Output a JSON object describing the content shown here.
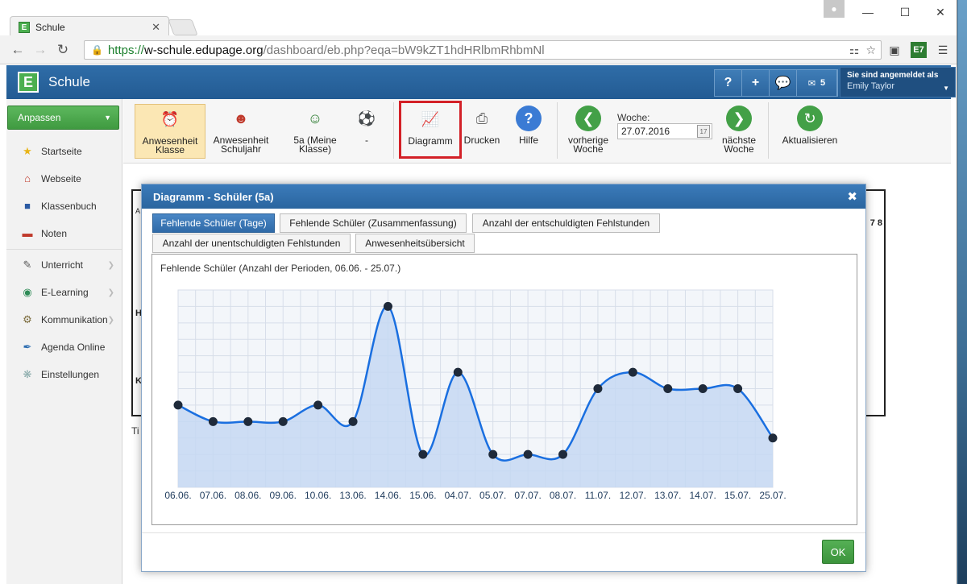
{
  "browser": {
    "tab_title": "Schule",
    "tab_favicon": "E",
    "url_scheme": "https://",
    "url_host": "w-schule.edupage.org",
    "url_path": "/dashboard/eb.php?eqa=bW9kZT1hdHRlbmRhbmNl"
  },
  "app": {
    "title": "Schule",
    "logo_letter": "E",
    "help_label": "?",
    "add_label": "+",
    "mail_count": "5",
    "user_label": "Sie sind angemeldet als",
    "user_name": "Emily Taylor"
  },
  "sidebar": {
    "customize_label": "Anpassen",
    "items": [
      {
        "label": "Startseite",
        "icon": "star-icon"
      },
      {
        "label": "Webseite",
        "icon": "house-icon"
      },
      {
        "label": "Klassenbuch",
        "icon": "book-icon"
      },
      {
        "label": "Noten",
        "icon": "notes-icon"
      },
      {
        "label": "Unterricht",
        "icon": "pencil-icon"
      },
      {
        "label": "E-Learning",
        "icon": "globe-icon"
      },
      {
        "label": "Kommunikation",
        "icon": "gear-icon"
      },
      {
        "label": "Agenda Online",
        "icon": "feather-icon"
      },
      {
        "label": "Einstellungen",
        "icon": "settings-icon"
      }
    ]
  },
  "toolbar": {
    "attendance_class_1": "Anwesenheit",
    "attendance_class_2": "Klasse",
    "attendance_year_1": "Anwesenheit",
    "attendance_year_2": "Schuljahr",
    "my_class_1": "5a (Meine",
    "my_class_2": "Klasse)",
    "dash_label": "-",
    "diagram_label": "Diagramm",
    "print_label": "Drucken",
    "help_label": "Hilfe",
    "prev_week_1": "vorherige",
    "prev_week_2": "Woche",
    "week_label": "Woche:",
    "week_value": "27.07.2016",
    "next_week_1": "nächste",
    "next_week_2": "Woche",
    "refresh_label": "Aktualisieren"
  },
  "modal": {
    "title": "Diagramm - Schüler (5a)",
    "tabs": [
      "Fehlende Schüler (Tage)",
      "Fehlende Schüler (Zusammenfassung)",
      "Anzahl der entschuldigten Fehlstunden",
      "Anzahl der unentschuldigten Fehlstunden",
      "Anwesenheitsübersicht"
    ],
    "ok_label": "OK"
  },
  "background": {
    "hint_text": "Ti",
    "col_nums": "7 8",
    "letter_h": "H",
    "letter_k": "K",
    "letter_a": "A"
  },
  "colors": {
    "header_blue": "#2a659f",
    "accent_green": "#4caf50",
    "highlight_red": "#d32027",
    "chart_line": "#1a6fe0",
    "chart_fill": "#c5d8f2"
  },
  "chart_data": {
    "type": "area",
    "title": "Fehlende Schüler (Anzahl der Perioden, 06.06. - 25.07.)",
    "categories": [
      "06.06.",
      "07.06.",
      "08.06.",
      "09.06.",
      "10.06.",
      "13.06.",
      "14.06.",
      "15.06.",
      "04.07.",
      "05.07.",
      "07.07.",
      "08.07.",
      "11.07.",
      "12.07.",
      "13.07.",
      "14.07.",
      "15.07.",
      "25.07."
    ],
    "values": [
      5,
      4,
      4,
      4,
      5,
      4,
      11,
      2,
      7,
      2,
      2,
      2,
      6,
      7,
      6,
      6,
      6,
      3
    ],
    "ylim": [
      0,
      12
    ],
    "grid": true
  }
}
